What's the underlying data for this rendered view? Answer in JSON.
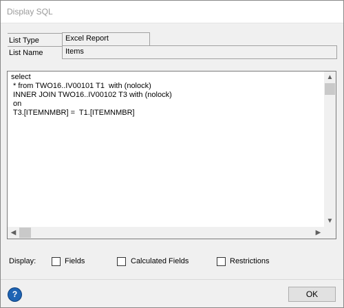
{
  "window": {
    "title": "Display SQL"
  },
  "list_info": {
    "list_type_label": "List Type",
    "list_type_value": "Excel Report",
    "list_name_label": "List Name",
    "list_name_value": "Items"
  },
  "sql_text": "select\n * from TWO16..IV00101 T1  with (nolock)\n INNER JOIN TWO16..IV00102 T3 with (nolock)\n on\n T3.[ITEMNMBR] =  T1.[ITEMNMBR]",
  "display": {
    "label": "Display:",
    "options": [
      {
        "label": "Fields",
        "checked": false
      },
      {
        "label": "Calculated Fields",
        "checked": false
      },
      {
        "label": "Restrictions",
        "checked": false
      }
    ]
  },
  "buttons": {
    "ok": "OK",
    "help_icon": "help-icon"
  }
}
